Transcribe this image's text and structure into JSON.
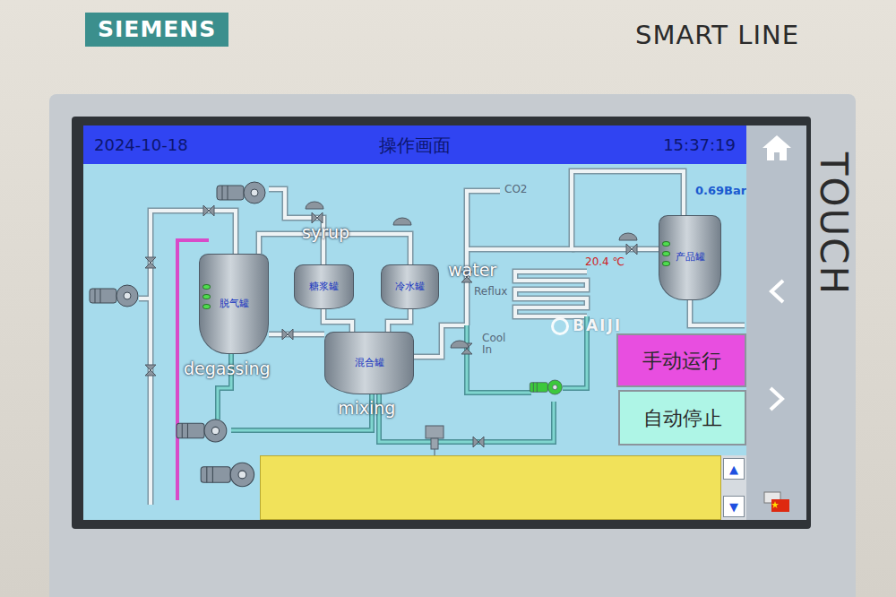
{
  "bezel": {
    "brand": "SIEMENS",
    "model": "SMART LINE",
    "touch": "TOUCH"
  },
  "header": {
    "date": "2024-10-18",
    "title": "操作画面",
    "time": "15:37:19"
  },
  "tanks": [
    {
      "label": "脱气罐"
    },
    {
      "label": "糖浆罐"
    },
    {
      "label": "冷水罐"
    },
    {
      "label": "混合罐"
    },
    {
      "label": "产品罐"
    }
  ],
  "pipe_labels": [
    "CO2",
    "Reflux",
    "Cool In"
  ],
  "readings": {
    "pressure": "0.69Bar",
    "temperature": "20.4 ℃"
  },
  "pumps": [
    {
      "running": false
    },
    {
      "running": false
    },
    {
      "running": false
    },
    {
      "running": false
    },
    {
      "running": true
    }
  ],
  "control_buttons": [
    {
      "label": "手动运行",
      "color": "#e84ee0"
    },
    {
      "label": "自动停止",
      "color": "#aef5e6"
    }
  ],
  "alarm_panel": {
    "scroll_up": "▲",
    "scroll_down": "▼"
  },
  "annotations": [
    "syrup",
    "water",
    "degassing",
    "mixing"
  ],
  "watermark": "BAIJI"
}
